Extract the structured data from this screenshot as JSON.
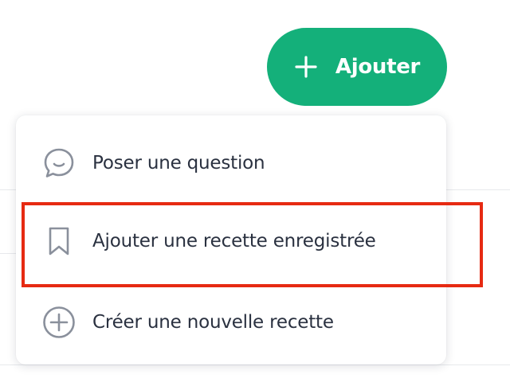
{
  "add_button": {
    "label": "Ajouter",
    "icon": "plus-icon",
    "color": "#14b07a"
  },
  "menu": {
    "items": [
      {
        "label": "Poser une question",
        "icon": "chat-bubble-icon"
      },
      {
        "label": "Ajouter une recette enregistrée",
        "icon": "bookmark-icon",
        "highlighted": true
      },
      {
        "label": "Créer une nouvelle recette",
        "icon": "plus-circle-icon"
      }
    ]
  },
  "highlight": {
    "color": "#e62a12"
  }
}
